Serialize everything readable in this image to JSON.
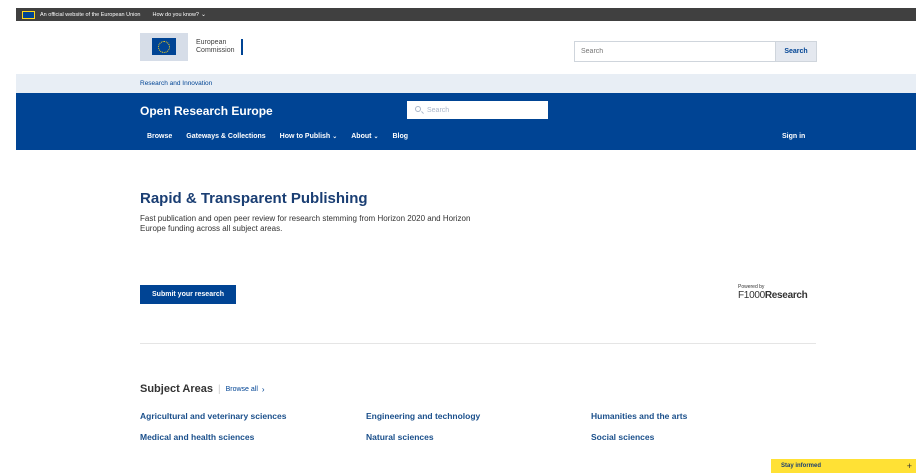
{
  "eu_bar": {
    "official_text": "An official website of the European Union",
    "how_know": "How do you know?"
  },
  "ec_header": {
    "logo_line1": "European",
    "logo_line2": "Commission",
    "search_placeholder": "Search",
    "search_button": "Search"
  },
  "site_strip": {
    "label": "Research and Innovation"
  },
  "ore": {
    "title": "Open Research Europe",
    "search_placeholder": "Search",
    "nav": [
      {
        "label": "Browse"
      },
      {
        "label": "Gateways & Collections"
      },
      {
        "label": "How to Publish"
      },
      {
        "label": "About"
      },
      {
        "label": "Blog"
      }
    ],
    "sign_in": "Sign in"
  },
  "hero": {
    "title": "Rapid & Transparent Publishing",
    "description": "Fast publication and open peer review for research stemming from Horizon 2020 and Horizon Europe funding across all subject areas.",
    "submit_label": "Submit your research"
  },
  "powered": {
    "prefix": "Powered by",
    "brand_f": "F1000",
    "brand_r": "Research"
  },
  "subjects": {
    "heading": "Subject Areas",
    "browse_all": "Browse all",
    "items": [
      {
        "label": "Agricultural and veterinary sciences"
      },
      {
        "label": "Engineering and technology"
      },
      {
        "label": "Humanities and the arts"
      },
      {
        "label": "Medical and health sciences"
      },
      {
        "label": "Natural sciences"
      },
      {
        "label": "Social sciences"
      }
    ]
  },
  "stay_informed": {
    "label": "Stay informed",
    "plus": "+"
  },
  "colors": {
    "eu_blue": "#004494",
    "dark_bar": "#404040",
    "highlight_yellow": "#ffe135"
  }
}
